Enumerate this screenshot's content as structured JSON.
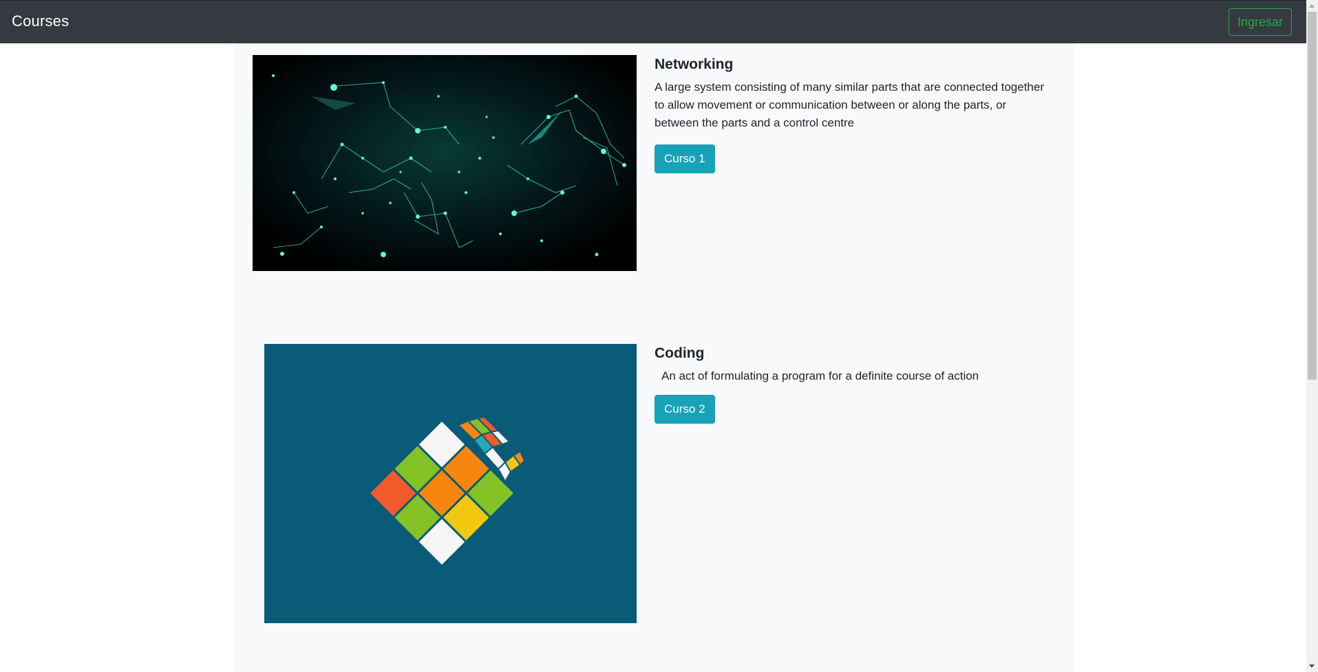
{
  "navbar": {
    "brand": "Courses",
    "login_label": "Ingresar"
  },
  "courses": [
    {
      "title": "Networking",
      "description": "A large system consisting of many similar parts that are connected together to allow movement or communication between or along the parts, or between the parts and a control centre",
      "button_label": "Curso 1",
      "image_icon": "network-graph-image"
    },
    {
      "title": "Coding",
      "description": "An act of formulating a program for a definite course of action",
      "button_label": "Curso 2",
      "image_icon": "rubiks-cube-image"
    }
  ],
  "colors": {
    "navbar_bg": "#343a40",
    "login_outline": "#28a745",
    "course_button": "#17a2b8",
    "container_bg": "#f8f9fa",
    "coding_image_bg": "#0a5b78"
  }
}
